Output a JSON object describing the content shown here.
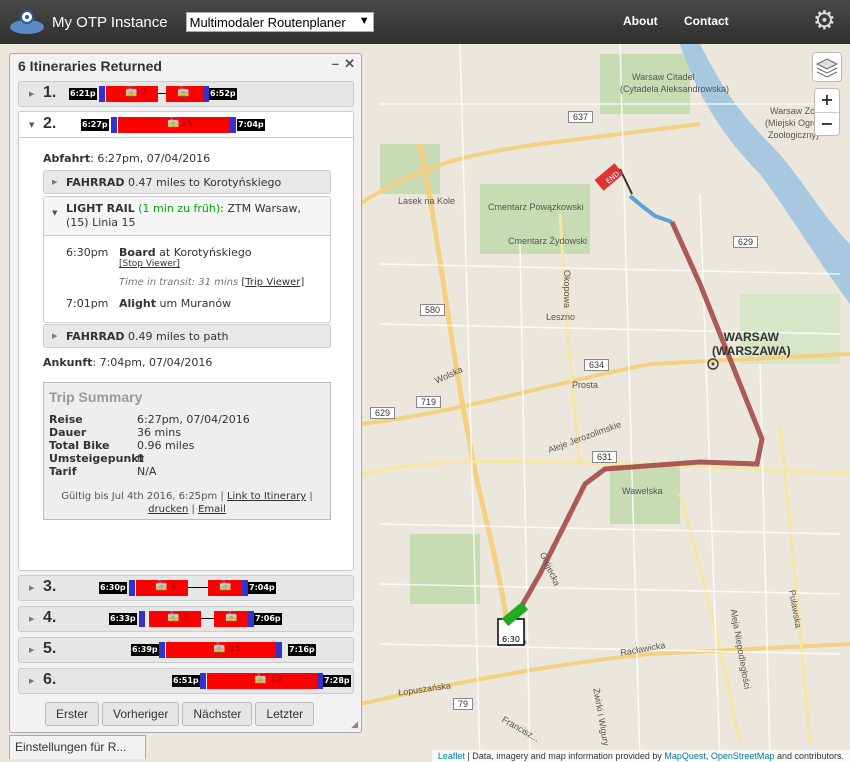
{
  "nav": {
    "brand": "My OTP Instance",
    "mode_select": "Multimodaler Routenplaner",
    "about": "About",
    "contact": "Contact",
    "logo_icon": "otp-logo-icon",
    "settings_icon": "gear-icon"
  },
  "panel": {
    "title": "6 Itineraries Returned",
    "minimize": "–",
    "close": "✕"
  },
  "itineraries": [
    {
      "num": "1.",
      "start": "6:21p",
      "end": "6:52p",
      "route1": "7",
      "route2": ""
    },
    {
      "num": "2.",
      "start": "6:27p",
      "end": "7:04p",
      "route1": "15"
    },
    {
      "num": "3.",
      "start": "6:30p",
      "end": "7:04p",
      "route1": "8",
      "route2": ""
    },
    {
      "num": "4.",
      "start": "6:33p",
      "end": "7:06p",
      "route1": "2",
      "route2": ""
    },
    {
      "num": "5.",
      "start": "6:39p",
      "end": "7:16p",
      "route1": "15"
    },
    {
      "num": "6.",
      "start": "6:51p",
      "end": "7:28p",
      "route1": "18"
    }
  ],
  "detail": {
    "depart_label": "Abfahrt",
    "depart_value": ": 6:27pm, 07/04/2016",
    "leg1_mode": "FAHRRAD",
    "leg1_text": " 0.47 miles to Korotyńskiego",
    "leg2_mode": "LIGHT RAIL",
    "leg2_early": " (1 min zu früh)",
    "leg2_agency": ": ZTM Warsaw,",
    "leg2_line": "(15) Linia 15",
    "board_time": "6:30pm",
    "board_label": "Board",
    "board_at": " at Korotyńskiego",
    "stop_viewer": "[Stop Viewer]",
    "transit_time": "Time in transit: 31 mins",
    "trip_viewer": "Trip Viewer",
    "alight_time": "7:01pm",
    "alight_label": "Alight",
    "alight_at": " um Muranów",
    "leg3_mode": "FAHRRAD",
    "leg3_text": " 0.49 miles to path",
    "arrive_label": "Ankunft",
    "arrive_value": ": 7:04pm, 07/04/2016"
  },
  "summary": {
    "title": "Trip Summary",
    "rows": [
      {
        "k": "Reise",
        "v": "6:27pm, 07/04/2016"
      },
      {
        "k": "Dauer",
        "v": "36 mins"
      },
      {
        "k": "Total Bike",
        "v": "0.96 miles"
      },
      {
        "k": "Umsteigepunkt",
        "v": "0"
      },
      {
        "k": "Tarif",
        "v": "N/A"
      }
    ],
    "valid": "Gültig bis Jul 4th 2016, 6:25pm | ",
    "link_itin": "Link to Itinerary",
    "print": "drucken",
    "email": "Email"
  },
  "pager": {
    "first": "Erster",
    "prev": "Vorheriger",
    "next": "Nächster",
    "last": "Letzter"
  },
  "settings_tab": "Einstellungen für R...",
  "map": {
    "labels": {
      "warsaw": "WARSAW",
      "warszawa": "(WARSZAWA)",
      "cytadela": "Warsaw Citadel",
      "cytadela_pl": "(Cytadela Aleksandrowska)",
      "zoo": "Warsaw Zoo",
      "zoo_pl": "(Miejski Ogród",
      "zoo_pl2": "Zoologiczny)",
      "powazkowski": "Cmentarz Powązkowski",
      "zydowski": "Cmentarz Żydowski",
      "lasek": "Lasek na Kole",
      "okopowa": "Okopowa",
      "leszno": "Leszno",
      "prosta": "Prosta",
      "wolska": "Wolska",
      "jerozolimskie": "Aleje Jerozolimskie",
      "wawelska": "Wawelska",
      "grojecka": "Grójecka",
      "raclawicka": "Racławicka",
      "lopuszanska": "Łopuszańska",
      "pulawska": "Puławska",
      "niepodleglosci": "Aleja Niepodległości",
      "wilgi": "Żwirki i Wigury",
      "franciszka": "Francisz..."
    },
    "badges": [
      "637",
      "629",
      "580",
      "634",
      "719",
      "629",
      "631",
      "79"
    ],
    "start_time": "6:30",
    "end_label": "END",
    "zoom_in": "+",
    "zoom_out": "−",
    "layers_icon": "layers-icon"
  },
  "attribution": {
    "leaflet": "Leaflet",
    "text": " | Data, imagery and map information provided by ",
    "mapquest": "MapQuest",
    "sep": ", ",
    "osm": "OpenStreetMap",
    "tail": " and contributors."
  },
  "colors": {
    "route_rail": "#a0413f",
    "route_bike": "#4a90d9",
    "timeline_red": "#ff0000",
    "timeline_bike": "#3333cc"
  }
}
